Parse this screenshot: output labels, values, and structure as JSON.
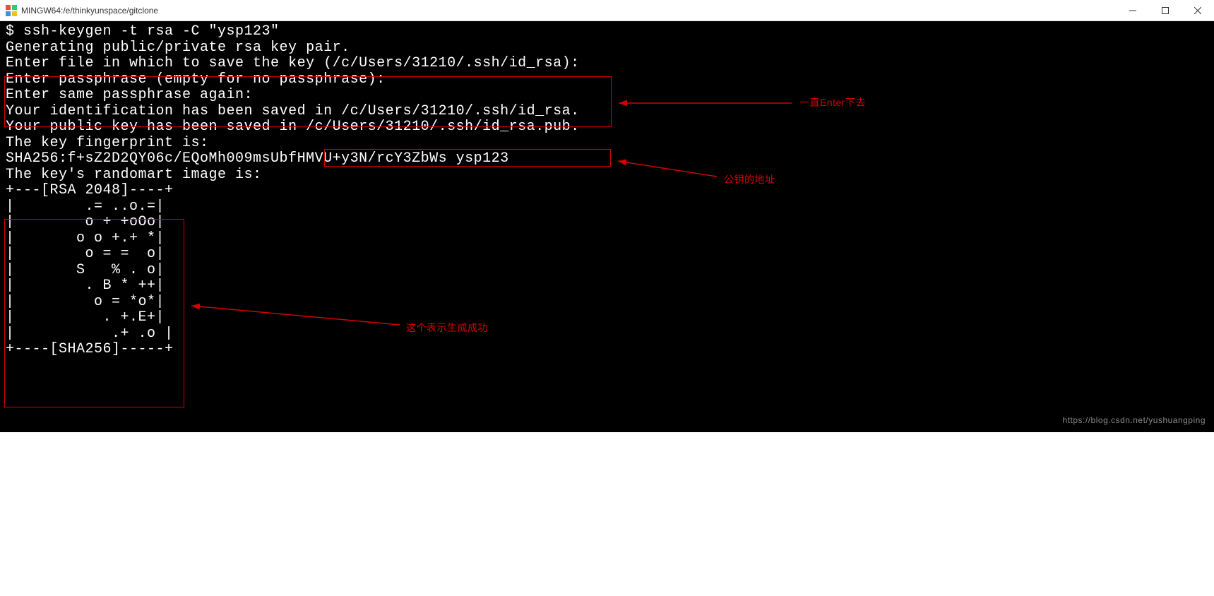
{
  "titlebar": {
    "title": "MINGW64:/e/thinkyunspace/gitclone"
  },
  "terminal": {
    "lines": [
      "$ ssh-keygen -t rsa -C \"ysp123\"",
      "Generating public/private rsa key pair.",
      "Enter file in which to save the key (/c/Users/31210/.ssh/id_rsa):",
      "Enter passphrase (empty for no passphrase):",
      "Enter same passphrase again:",
      "Your identification has been saved in /c/Users/31210/.ssh/id_rsa.",
      "Your public key has been saved in /c/Users/31210/.ssh/id_rsa.pub.",
      "The key fingerprint is:",
      "SHA256:f+sZ2D2QY06c/EQoMh009msUbfHMVU+y3N/rcY3ZbWs ysp123",
      "The key's randomart image is:",
      "+---[RSA 2048]----+",
      "|        .= ..o.=|",
      "|        o + +oOo|",
      "|       o o +.+ *|",
      "|        o = =  o|",
      "|       S   % . o|",
      "|        . B * ++|",
      "|         o = *o*|",
      "|          . +.E+|",
      "|           .+ .o |",
      "+----[SHA256]-----+"
    ]
  },
  "annotations": {
    "label1": "一直Enter下去",
    "label2": "公钥的地址",
    "label3": "这个表示生成成功"
  },
  "watermark": {
    "text": "https://blog.csdn.net/yushuangping"
  }
}
